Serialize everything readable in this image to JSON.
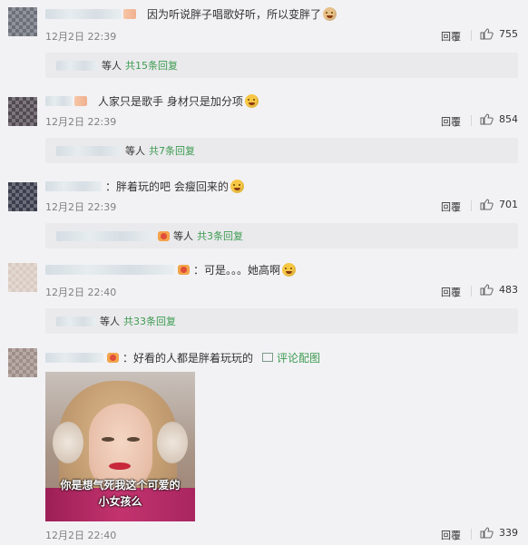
{
  "comments": [
    {
      "text": "因为听说胖子唱歌好听，所以变胖了",
      "emoji": "dog-face-emoji",
      "time": "12月2日 22:39",
      "reply_label": "回覆",
      "likes": "755",
      "sub": {
        "others": "等人",
        "count": "共15条回复"
      }
    },
    {
      "text": "人家只是歌手 身材只是加分项",
      "emoji": "laughing-emoji",
      "time": "12月2日 22:39",
      "reply_label": "回覆",
      "likes": "854",
      "sub": {
        "others": "等人",
        "count": "共7条回复"
      }
    },
    {
      "text": "：胖着玩的吧 会瘦回来的",
      "emoji": "smirk-emoji",
      "time": "12月2日 22:39",
      "reply_label": "回覆",
      "likes": "701",
      "sub": {
        "others": "等人",
        "count": "共3条回复"
      }
    },
    {
      "text": "：可是。。。她高啊",
      "emoji": "laughing-emoji",
      "time": "12月2日 22:40",
      "reply_label": "回覆",
      "likes": "483",
      "sub": {
        "others": "等人",
        "count": "共33条回复"
      }
    },
    {
      "text": "：好看的人都是胖着玩玩的",
      "pic_link": "评论配图",
      "time": "12月2日 22:40",
      "reply_label": "回覆",
      "likes": "339",
      "image_caption_1": "你是想气死我这个可爱的",
      "image_caption_2": "小女孩么"
    }
  ],
  "colors": {
    "accent_green": "#3d9b50",
    "background": "#f2f2f5",
    "subbox": "#eaeaed",
    "meta_gray": "#808080"
  }
}
